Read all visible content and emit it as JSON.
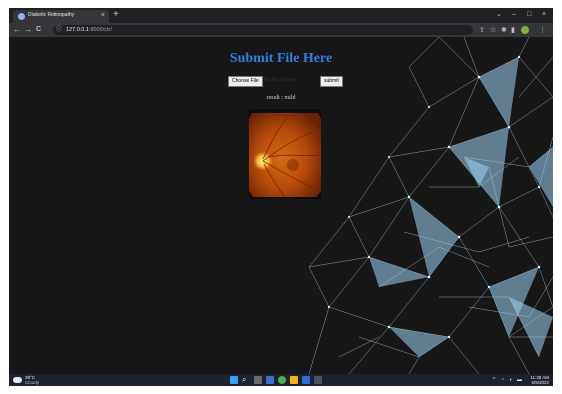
{
  "browser": {
    "tab_title": "Diabetic Retinopathy",
    "tab_close": "×",
    "new_tab": "+",
    "window_controls": {
      "collapse": "⌄",
      "minimize": "–",
      "maximize": "□",
      "close": "×"
    },
    "nav": {
      "back": "←",
      "forward": "→",
      "reload": "C"
    },
    "address": {
      "host": "127.0.0.1",
      "rest": ":8000/ctr/"
    },
    "right_icons": [
      "share-icon",
      "star-icon",
      "extensions-icon",
      "sidebar-icon",
      "profile-icon",
      "menu-icon"
    ]
  },
  "page": {
    "heading": "Submit File Here",
    "choose_file_label": "Choose File",
    "file_name": "No file chosen",
    "submit_label": "submit",
    "result_text": "result : mild",
    "image_desc": "retina-fundus-image"
  },
  "taskbar": {
    "weather_temp": "28°C",
    "weather_desc": "Cloudy",
    "tray_time": "11:38 AM",
    "tray_date": "6/9/2022"
  },
  "colors": {
    "heading": "#2f7de0",
    "network": "#bfe6ff",
    "page_bg": "#171717"
  }
}
